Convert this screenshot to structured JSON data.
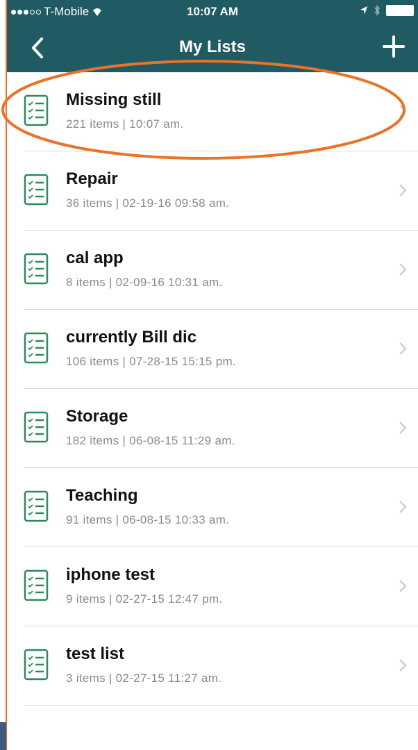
{
  "status_bar": {
    "carrier": "T-Mobile",
    "time": "10:07 AM"
  },
  "nav": {
    "title": "My Lists",
    "back_icon": "chevron-left-icon",
    "add_icon": "plus-icon"
  },
  "lists": [
    {
      "name": "Missing still",
      "count": "221 items",
      "date": "10:07 am."
    },
    {
      "name": "Repair",
      "count": "36 items",
      "date": "02-19-16 09:58 am."
    },
    {
      "name": "cal app",
      "count": "8 items",
      "date": "02-09-16 10:31 am."
    },
    {
      "name": "currently Bill dic",
      "count": "106 items",
      "date": "07-28-15 15:15 pm."
    },
    {
      "name": "Storage",
      "count": "182 items",
      "date": "06-08-15 11:29 am."
    },
    {
      "name": "Teaching",
      "count": "91 items",
      "date": "06-08-15 10:33 am."
    },
    {
      "name": "iphone test",
      "count": "9 items",
      "date": "02-27-15 12:47 pm."
    },
    {
      "name": "test list",
      "count": "3 items",
      "date": "02-27-15 11:27 am."
    }
  ],
  "annotation": {
    "highlight_color": "#e8732a",
    "highlighted_item": "Missing still"
  },
  "colors": {
    "nav_bar": "#205b63",
    "meta_text": "#8a8a8a",
    "icon_green": "#2c8a5a"
  }
}
